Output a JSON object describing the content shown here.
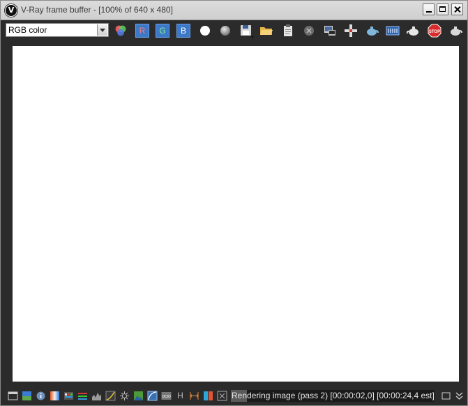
{
  "window": {
    "title": "V-Ray frame buffer - [100% of 640 x 480]",
    "app_icon_glyph": "V"
  },
  "toolbar": {
    "channel_select": {
      "value": "RGB color"
    },
    "red_label": "R",
    "green_label": "G",
    "blue_label": "B",
    "icons": [
      "color-channels-icon",
      "red-channel-icon",
      "green-channel-icon",
      "blue-channel-icon",
      "alpha-channel-icon",
      "mono-mode-icon",
      "save-image-icon",
      "load-image-icon",
      "clear-image-icon",
      "clear-icon",
      "duplicate-to-max-vfb-icon",
      "track-mouse-icon",
      "render-last-icon",
      "lens-effects-icon",
      "region-render-icon",
      "stop-render-icon",
      "render-icon"
    ],
    "stop_label": "STOP"
  },
  "statusbar": {
    "icons": [
      "toggle-panel-icon",
      "color-correction-icon",
      "info-icon",
      "gradient-icon",
      "lut-icon",
      "levels-icon",
      "histogram-icon",
      "curve-icon",
      "exposure-icon",
      "background-icon",
      "srgb-icon",
      "ocio-icon",
      "h-icon",
      "compare-icon",
      "ab-compare-icon",
      "pixel-aspect-icon"
    ],
    "ocio_label": "OCIO",
    "h_label": "H",
    "status": "Rendering image (pass 2) [00:00:02,0] [00:00:24,4 est]",
    "progress": 0.08
  },
  "colors": {
    "frame": "#2b2b2b",
    "accent_blue": "#3c79c8",
    "stop_red": "#d92b2b"
  }
}
